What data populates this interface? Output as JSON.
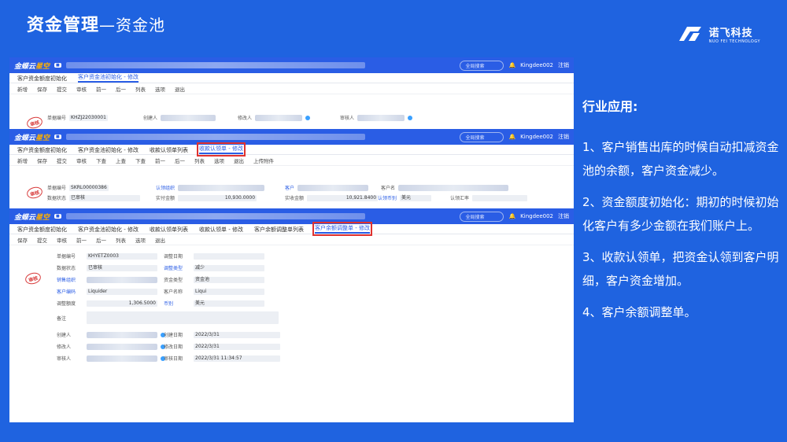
{
  "header": {
    "title": "资金管理",
    "subtitle": "—资金池"
  },
  "logo": {
    "cn": "诺飞科技",
    "en": "NUO FEI TECHNOLOGY"
  },
  "panel": {
    "heading": "行业应用:",
    "items": [
      "1、客户销售出库的时候自动扣减资金池的余额，客户资金减少。",
      "2、资金额度初始化：期初的时候初始化客户有多少金额在我们账户上。",
      "3、收款认领单，把资金认领到客户明细，客户资金增加。",
      "4、客户余额调整单。"
    ]
  },
  "app": {
    "brand1": "金蝶云",
    "brand2": "星空",
    "search": "全局搜索",
    "user": "Kingdee002",
    "logout": "注销",
    "stamp": "审核"
  },
  "s1": {
    "tabs": [
      "客户资金额度初始化",
      "客户资金池初始化 - 修改"
    ],
    "tools": [
      "新增",
      "保存",
      "提交",
      "审核",
      "前一",
      "后一",
      "列表",
      "选项",
      "退出"
    ],
    "f1": "单据编号",
    "v1": "KHZJ22030001",
    "f2": "创建人",
    "f3": "修改人",
    "f4": "审核人"
  },
  "s2": {
    "tabs": [
      "客户资金额度初始化",
      "客户资金池初始化 - 修改",
      "收款认领单列表",
      "收款认领单 - 修改"
    ],
    "tools": [
      "新增",
      "保存",
      "提交",
      "审核",
      "下查",
      "上查",
      "下查",
      "前一",
      "后一",
      "列表",
      "选项",
      "退出",
      "上传附件"
    ],
    "f1": "单据编号",
    "v1": "SKRL00000386",
    "f2": "数据状态",
    "v2": "已审核",
    "f3": "认领组织",
    "f4": "实付金额",
    "v4": "10,930.0000",
    "f5": "客户",
    "f6": "实收金额",
    "v6": "10,921.8400",
    "f7": "认领币别",
    "v7": "美元",
    "f8": "客户名",
    "f9": "认领汇率"
  },
  "s3": {
    "tabs": [
      "客户资金额度初始化",
      "客户资金池初始化 - 修改",
      "收款认领单列表",
      "收款认领单 - 修改",
      "客户余额调整单列表",
      "客户余额调整单 - 修改"
    ],
    "tools": [
      "保存",
      "提交",
      "审核",
      "前一",
      "后一",
      "列表",
      "选项",
      "退出"
    ],
    "left": [
      {
        "l": "单据编号",
        "v": "KHYETZ0003"
      },
      {
        "l": "数据状态",
        "v": "已审核"
      },
      {
        "l": "销售组织",
        "v": ""
      },
      {
        "l": "客户编码",
        "v": "Liquider"
      },
      {
        "l": "调整额度",
        "v": "1,306.5000"
      },
      {
        "l": "备注",
        "v": ""
      }
    ],
    "right": [
      {
        "l": "调整日期",
        "v": ""
      },
      {
        "l": "调整类型",
        "v": "减少"
      },
      {
        "l": "资金类型",
        "v": "资金池"
      },
      {
        "l": "客户名称",
        "v": "Liqui"
      },
      {
        "l": "币别",
        "v": "美元"
      }
    ],
    "bottomL": [
      {
        "l": "创建人",
        "v": ""
      },
      {
        "l": "修改人",
        "v": ""
      },
      {
        "l": "审核人",
        "v": ""
      }
    ],
    "bottomR": [
      {
        "l": "创建日期",
        "v": "2022/3/31"
      },
      {
        "l": "修改日期",
        "v": "2022/3/31"
      },
      {
        "l": "审核日期",
        "v": "2022/3/31 11:34:57"
      }
    ]
  }
}
